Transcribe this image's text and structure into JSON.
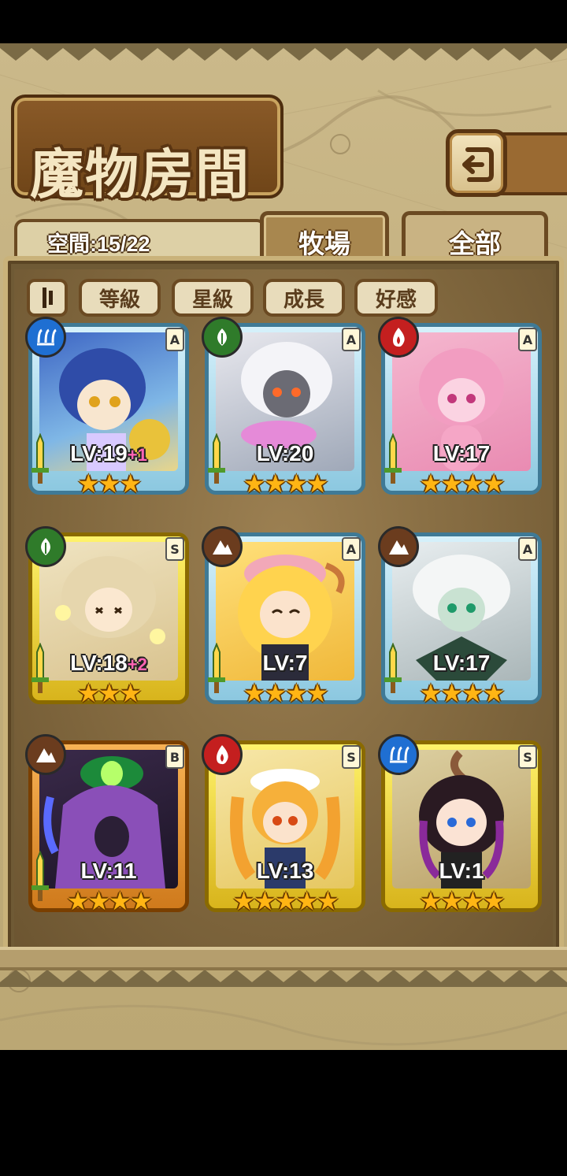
{
  "header": {
    "title": "魔物房間",
    "back_icon": "return-arrow-icon"
  },
  "space": {
    "label": "空間:15/22"
  },
  "tabs": [
    {
      "label": "牧場",
      "active": true
    },
    {
      "label": "全部",
      "active": false
    }
  ],
  "filters": {
    "sort_icon": "sort-order-icon",
    "items": [
      "等級",
      "星級",
      "成長",
      "好感"
    ]
  },
  "monsters": [
    {
      "level": "LV:19",
      "bonus": "+1",
      "stars": "★★★",
      "rank": "A",
      "element": "water",
      "frame": "blue",
      "has_sword": true
    },
    {
      "level": "LV:20",
      "bonus": "",
      "stars": "★★★★",
      "rank": "A",
      "element": "wood",
      "frame": "blue",
      "has_sword": true
    },
    {
      "level": "LV:17",
      "bonus": "",
      "stars": "★★★★",
      "rank": "A",
      "element": "fire",
      "frame": "blue",
      "has_sword": true
    },
    {
      "level": "LV:18",
      "bonus": "+2",
      "stars": "★★★",
      "rank": "S",
      "element": "wood",
      "frame": "gold",
      "has_sword": true
    },
    {
      "level": "LV:7",
      "bonus": "",
      "stars": "★★★★",
      "rank": "A",
      "element": "earth",
      "frame": "blue",
      "has_sword": true
    },
    {
      "level": "LV:17",
      "bonus": "",
      "stars": "★★★★",
      "rank": "A",
      "element": "earth",
      "frame": "blue",
      "has_sword": true
    },
    {
      "level": "LV:11",
      "bonus": "",
      "stars": "★★★★",
      "rank": "B",
      "element": "earth",
      "frame": "orange",
      "has_sword": true
    },
    {
      "level": "LV:13",
      "bonus": "",
      "stars": "★★★★★",
      "rank": "S",
      "element": "fire",
      "frame": "gold",
      "has_sword": false
    },
    {
      "level": "LV:1",
      "bonus": "",
      "stars": "★★★★",
      "rank": "S",
      "element": "water",
      "frame": "gold",
      "has_sword": false
    }
  ],
  "colors": {
    "blue_frame": "#8cc8e0",
    "gold_frame": "#f0d23a",
    "orange_frame": "#e89a3c",
    "star": "#ffb514",
    "bonus": "#ff64b4"
  }
}
